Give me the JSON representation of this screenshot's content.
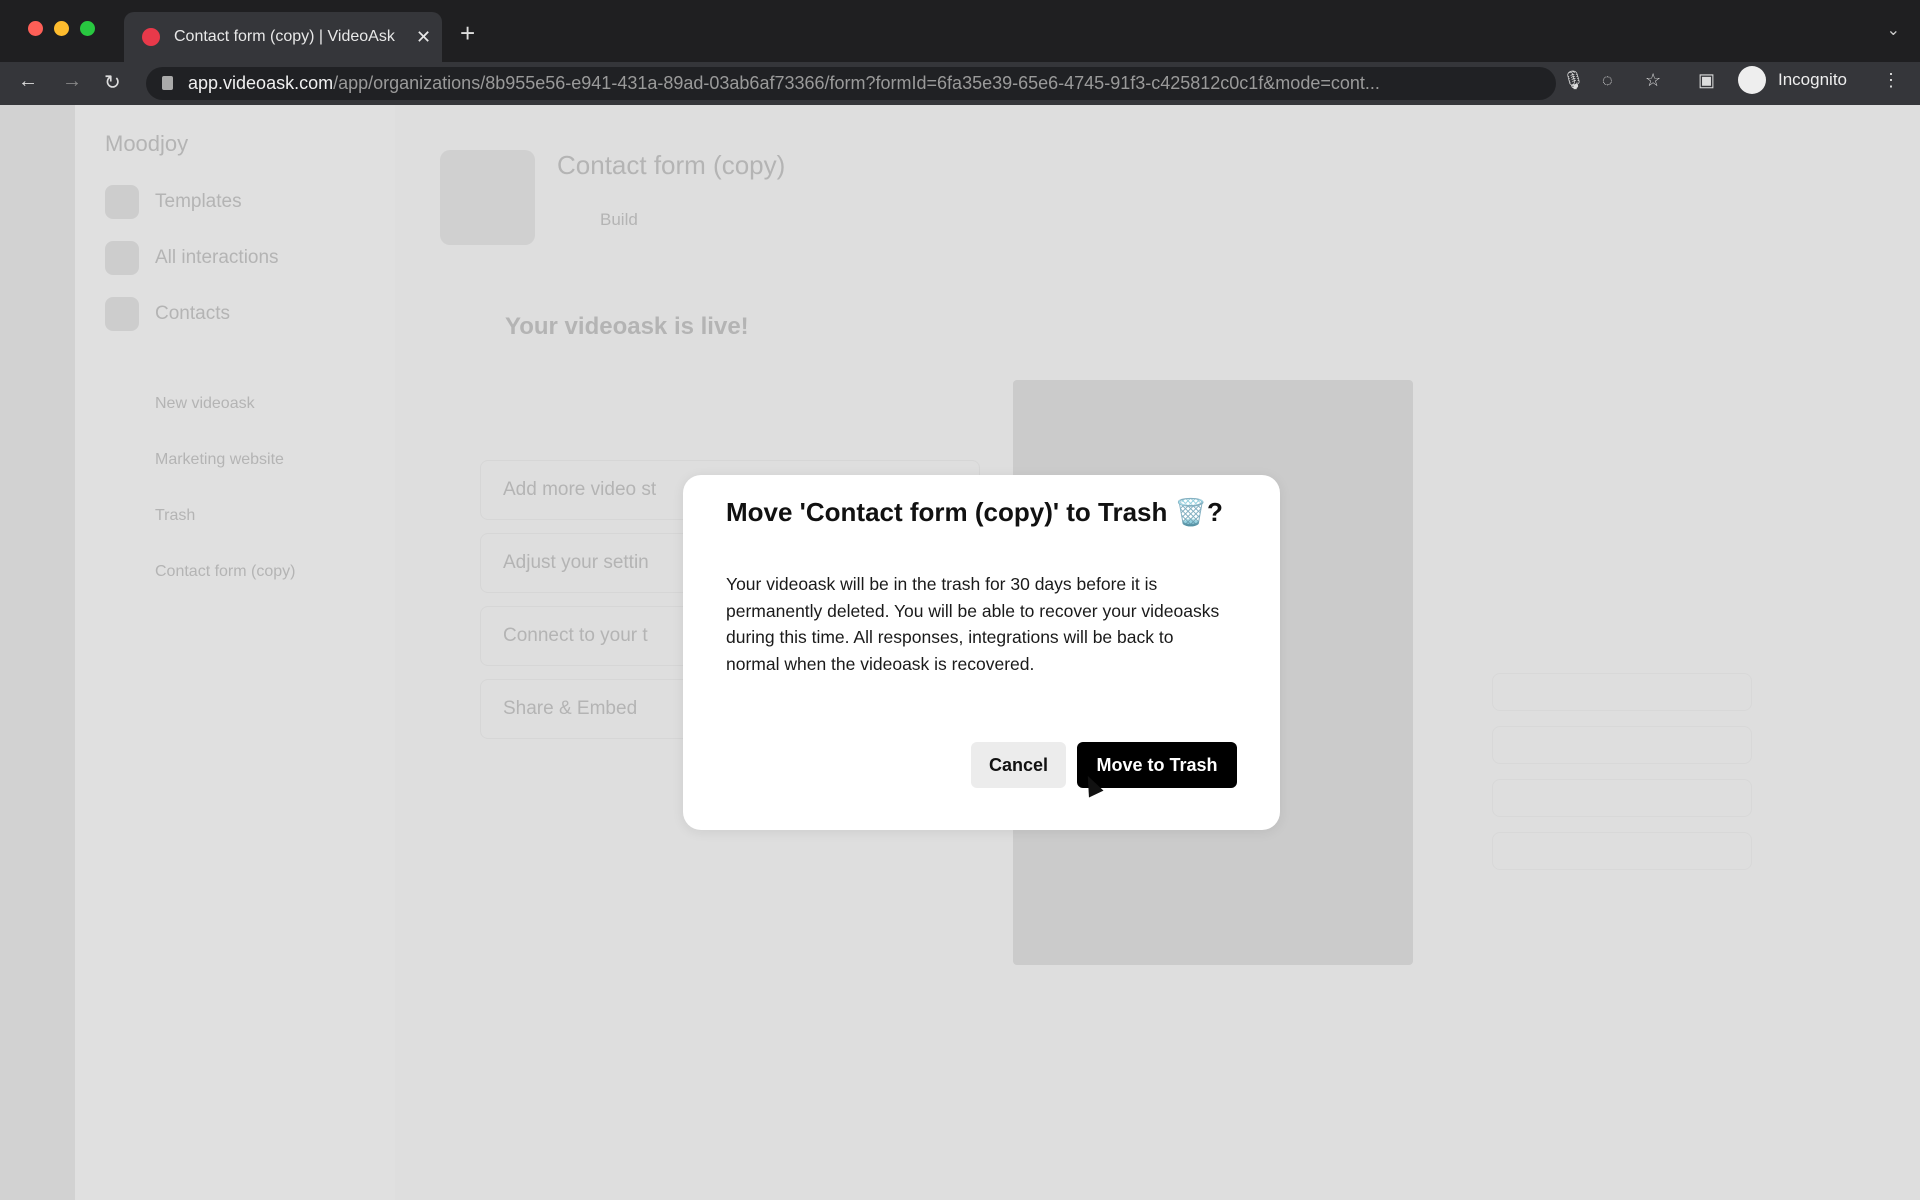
{
  "browser": {
    "tab_title": "Contact form (copy) | VideoAsk",
    "url_host": "app.videoask.com",
    "url_path": "/app/organizations/8b955e56-e941-431a-89ad-03ab6af73366/form?formId=6fa35e39-65e6-4745-91f3-c425812c0c1f&mode=cont...",
    "profile_label": "Incognito"
  },
  "sidebar": {
    "org": "Moodjoy",
    "items": [
      {
        "label": "Templates"
      },
      {
        "label": "All interactions"
      },
      {
        "label": "Contacts"
      }
    ],
    "new_label": "New videoask",
    "folders": [
      {
        "label": "Marketing website"
      },
      {
        "label": "Trash"
      },
      {
        "label": "Contact form (copy)"
      }
    ]
  },
  "main": {
    "title": "Contact form (copy)",
    "build_label": "Build",
    "live_heading": "Your videoask is live!",
    "steps": [
      {
        "label": "Add more video st"
      },
      {
        "label": "Adjust your settin"
      },
      {
        "label": "Connect to your t"
      },
      {
        "label": "Share & Embed"
      }
    ]
  },
  "modal": {
    "title": "Move 'Contact form (copy)' to Trash 🗑️?",
    "body": "Your videoask will be in the trash for 30 days before it is permanently deleted. You will be able to recover your videoasks during this time. All responses, integrations will be back to normal when the videoask is recovered.",
    "cancel_label": "Cancel",
    "confirm_label": "Move to Trash"
  }
}
